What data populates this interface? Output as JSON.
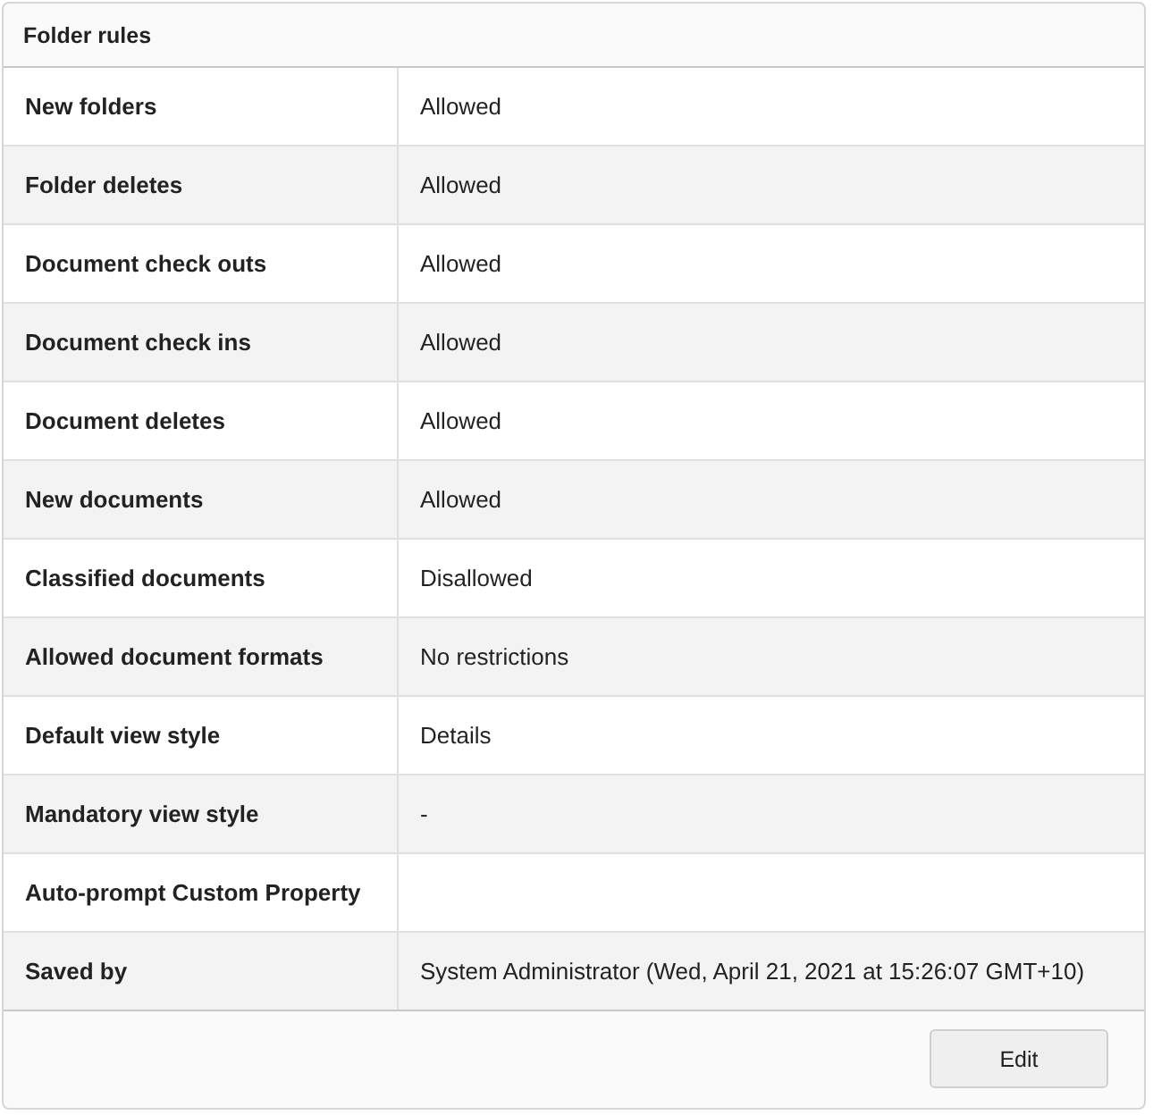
{
  "panel": {
    "title": "Folder rules"
  },
  "rows": [
    {
      "label": "New folders",
      "value": "Allowed"
    },
    {
      "label": "Folder deletes",
      "value": "Allowed"
    },
    {
      "label": "Document check outs",
      "value": "Allowed"
    },
    {
      "label": "Document check ins",
      "value": "Allowed"
    },
    {
      "label": "Document deletes",
      "value": "Allowed"
    },
    {
      "label": "New documents",
      "value": "Allowed"
    },
    {
      "label": "Classified documents",
      "value": "Disallowed"
    },
    {
      "label": "Allowed document formats",
      "value": "No restrictions"
    },
    {
      "label": "Default view style",
      "value": "Details"
    },
    {
      "label": "Mandatory view style",
      "value": "-"
    },
    {
      "label": "Auto-prompt Custom Property"
    },
    {
      "label": "Saved by",
      "value": "System Administrator (Wed, April 21, 2021 at 15:26:07 GMT+10)"
    }
  ],
  "buttons": [
    "Edit"
  ]
}
